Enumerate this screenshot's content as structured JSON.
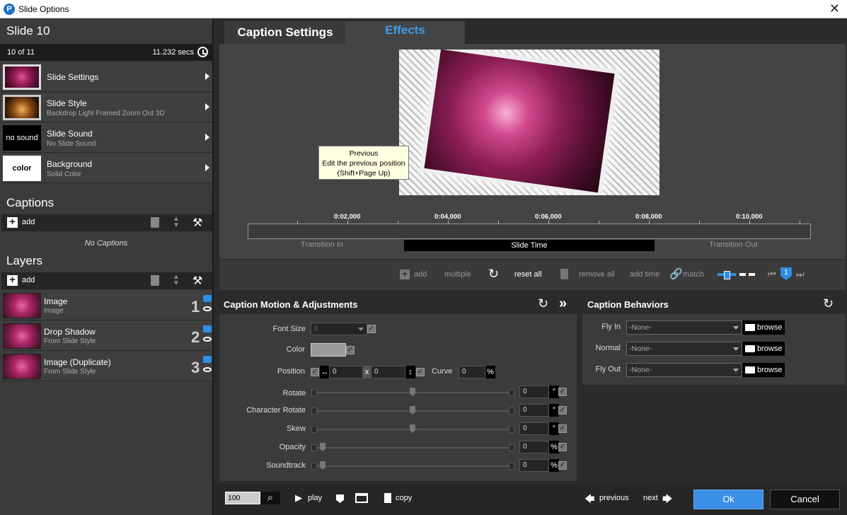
{
  "window": {
    "title": "Slide Options",
    "close_glyph": "✕"
  },
  "slide": {
    "title": "Slide 10",
    "position": "10 of 11",
    "duration": "11.232 secs"
  },
  "menu": [
    {
      "label": "Slide Settings",
      "sub": "",
      "thumb": ""
    },
    {
      "label": "Slide Style",
      "sub": "Backdrop Light Framed Zoom Out 3D",
      "thumb": ""
    },
    {
      "label": "Slide Sound",
      "sub": "No Slide Sound",
      "thumb": "no sound"
    },
    {
      "label": "Background",
      "sub": "Solid Color",
      "thumb": "color"
    }
  ],
  "captions": {
    "title": "Captions",
    "add_label": "add",
    "empty": "No Captions"
  },
  "layers": {
    "title": "Layers",
    "add_label": "add",
    "items": [
      {
        "name": "Image",
        "sub": "Image",
        "num": "1"
      },
      {
        "name": "Drop Shadow",
        "sub": "From Slide Style",
        "num": "2"
      },
      {
        "name": "Image (Duplicate)",
        "sub": "From Slide Style",
        "num": "3"
      }
    ]
  },
  "tabs": {
    "caption_settings": "Caption Settings",
    "effects": "Effects"
  },
  "tooltip": {
    "line1": "Previous",
    "line2": "Edit the previous position",
    "line3": "(Shift+Page Up)"
  },
  "timeline": {
    "ticks": [
      "0:02,000",
      "0:04,000",
      "0:06,000",
      "0:08,000",
      "0:10,000"
    ],
    "transition_in": "Transition In",
    "slide_time": "Slide Time",
    "transition_out": "Transition Out"
  },
  "actions": {
    "add": "add",
    "multiple": "multiple",
    "reset_all": "reset all",
    "remove_all": "remove all",
    "add_time": "add time",
    "match": "match",
    "marker_num": "1"
  },
  "caption_motion": {
    "title": "Caption Motion & Adjustments",
    "font_size_label": "Font Size",
    "font_size_value": "0",
    "color_label": "Color",
    "position_label": "Position",
    "pos_x": "0",
    "pos_sep": "x",
    "pos_y": "0",
    "curve_label": "Curve",
    "curve_value": "0",
    "curve_unit": "%",
    "rows": [
      {
        "label": "Rotate",
        "value": "0",
        "unit": "°"
      },
      {
        "label": "Character Rotate",
        "value": "0",
        "unit": "°"
      },
      {
        "label": "Skew",
        "value": "0",
        "unit": "°"
      },
      {
        "label": "Opacity",
        "value": "0",
        "unit": "%"
      },
      {
        "label": "Soundtrack",
        "value": "0",
        "unit": "%"
      }
    ]
  },
  "caption_behaviors": {
    "title": "Caption Behaviors",
    "rows": [
      {
        "label": "Fly In",
        "value": "-None-",
        "browse": "browse"
      },
      {
        "label": "Normal",
        "value": "-None-",
        "browse": "browse"
      },
      {
        "label": "Fly Out",
        "value": "-None-",
        "browse": "browse"
      }
    ]
  },
  "bottom": {
    "zoom": "100",
    "play": "play",
    "copy": "copy",
    "previous": "previous",
    "next": "next",
    "ok": "Ok",
    "cancel": "Cancel"
  },
  "colors": {
    "accent": "#3a8ee6",
    "effects_tab": "#3e9ce8",
    "ok_button": "#3a8ee6",
    "caption_color_swatch": "#9a9a9a"
  }
}
